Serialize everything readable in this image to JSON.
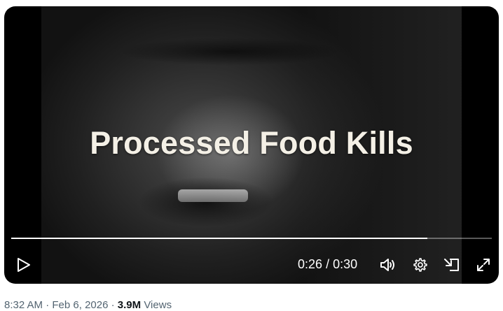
{
  "video": {
    "caption": "Processed Food Kills",
    "current_time": "0:26",
    "separator": "/",
    "duration": "0:30",
    "progress_fraction": 0.866
  },
  "controls": {
    "play_icon": "play-icon",
    "mute_icon": "speaker-icon",
    "settings_icon": "gear-icon",
    "pip_icon": "picture-in-picture-icon",
    "fullscreen_icon": "expand-icon"
  },
  "tweet_meta": {
    "time": "8:32 AM",
    "dot1": "·",
    "date": "Feb 6, 2026",
    "dot2": "·",
    "views_count": "3.9M",
    "views_label": "Views"
  }
}
